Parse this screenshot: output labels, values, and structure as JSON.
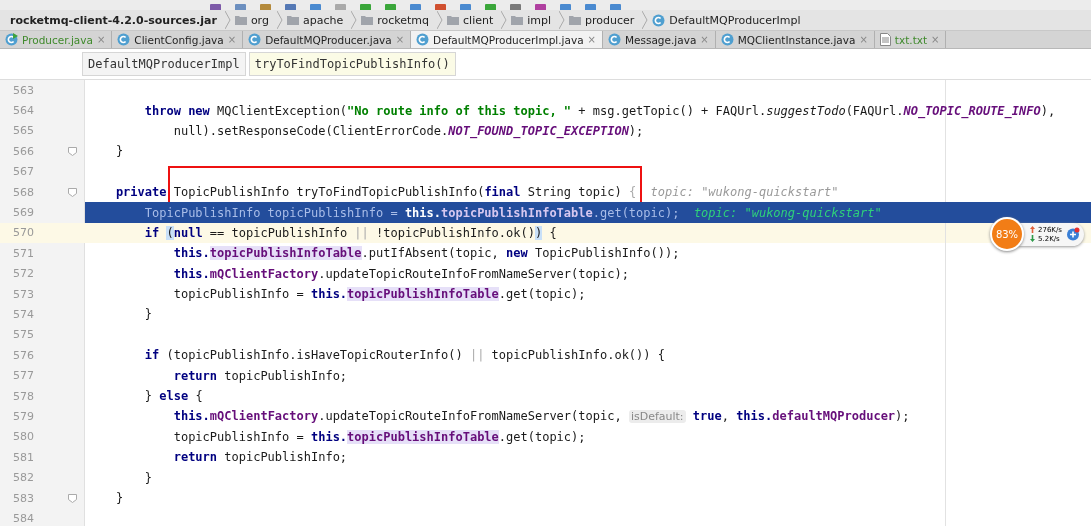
{
  "navigation_bar": {
    "items": [
      {
        "kind": "jar",
        "label": "rocketmq-client-4.2.0-sources.jar"
      },
      {
        "kind": "folder",
        "label": "org"
      },
      {
        "kind": "folder",
        "label": "apache"
      },
      {
        "kind": "folder",
        "label": "rocketmq"
      },
      {
        "kind": "folder",
        "label": "client"
      },
      {
        "kind": "folder",
        "label": "impl"
      },
      {
        "kind": "folder",
        "label": "producer"
      },
      {
        "kind": "class",
        "label": "DefaultMQProducerImpl"
      }
    ]
  },
  "tabs": [
    {
      "label": "Producer.java",
      "kind": "run_class",
      "vcs_added": true,
      "close": "×",
      "selected": false
    },
    {
      "label": "ClientConfig.java",
      "kind": "class",
      "vcs_added": false,
      "close": "×",
      "selected": false
    },
    {
      "label": "DefaultMQProducer.java",
      "kind": "class",
      "vcs_added": false,
      "close": "×",
      "selected": false
    },
    {
      "label": "DefaultMQProducerImpl.java",
      "kind": "class",
      "vcs_added": false,
      "close": "×",
      "selected": true
    },
    {
      "label": "Message.java",
      "kind": "class",
      "vcs_added": false,
      "close": "×",
      "selected": false
    },
    {
      "label": "MQClientInstance.java",
      "kind": "class",
      "vcs_added": false,
      "close": "×",
      "selected": false
    },
    {
      "label": "txt.txt",
      "kind": "text",
      "vcs_added": true,
      "close": "×",
      "selected": false
    }
  ],
  "structure_bar": [
    {
      "label": "DefaultMQProducerImpl",
      "selected": false
    },
    {
      "label": "tryToFindTopicPublishInfo()",
      "selected": true
    }
  ],
  "code": {
    "lines": [
      {
        "number": "563",
        "selected": false,
        "caret": false,
        "fold_marker": false
      },
      {
        "number": "564",
        "selected": false,
        "caret": false,
        "fold_marker": false,
        "tokens": [
          {
            "kind": "keyword",
            "text": "        throw new"
          },
          {
            "kind": "plain",
            "text": " MQClientException("
          },
          {
            "kind": "string",
            "text": "\"No route info of this topic, \""
          },
          {
            "kind": "plain",
            "text": " + msg.getTopic() + FAQUrl."
          },
          {
            "kind": "static",
            "text": "suggestTodo"
          },
          {
            "kind": "plain",
            "text": "(FAQUrl."
          },
          {
            "kind": "constant",
            "text": "NO_TOPIC_ROUTE_INFO"
          },
          {
            "kind": "plain",
            "text": "),"
          }
        ]
      },
      {
        "number": "565",
        "selected": false,
        "caret": false,
        "fold_marker": false,
        "tokens": [
          {
            "kind": "plain",
            "text": "            null).setResponseCode(ClientErrorCode."
          },
          {
            "kind": "constant",
            "text": "NOT_FOUND_TOPIC_EXCEPTION"
          },
          {
            "kind": "plain",
            "text": ");"
          }
        ]
      },
      {
        "number": "566",
        "selected": false,
        "caret": false,
        "fold_marker": true,
        "tokens": [
          {
            "kind": "plain",
            "text": "    }"
          }
        ]
      },
      {
        "number": "567",
        "selected": false,
        "caret": false,
        "fold_marker": false
      },
      {
        "number": "568",
        "selected": false,
        "caret": false,
        "fold_marker": true,
        "tokens": [
          {
            "kind": "keyword",
            "text": "    private "
          },
          {
            "kind": "plain",
            "text": "TopicPublishInfo tryToFindTopicPublishInfo(",
            "boxed": true
          },
          {
            "kind": "keyword",
            "text": "final",
            "boxed": true
          },
          {
            "kind": "plain",
            "text": " String topic)",
            "boxed": true
          },
          {
            "kind": "dim",
            "text": " {"
          },
          {
            "kind": "hint",
            "text": "  topic: \"wukong-quickstart\""
          }
        ]
      },
      {
        "number": "569",
        "selected": true,
        "caret": false,
        "fold_marker": false,
        "tokens": [
          {
            "kind": "plain",
            "text": "        TopicPublishInfo topicPublishInfo = "
          },
          {
            "kind": "keyword",
            "text": "this."
          },
          {
            "kind": "field",
            "text": "topicPublishInfoTable"
          },
          {
            "kind": "plain",
            "text": ".get(topic);"
          },
          {
            "kind": "hint",
            "text": "  topic: \"wukong-quickstart\""
          }
        ]
      },
      {
        "number": "570",
        "selected": false,
        "caret": true,
        "fold_marker": false,
        "tokens": [
          {
            "kind": "keyword",
            "text": "        if "
          },
          {
            "kind": "brace",
            "text": "("
          },
          {
            "kind": "keyword",
            "text": "null"
          },
          {
            "kind": "plain",
            "text": " == topicPublishInfo "
          },
          {
            "kind": "dim",
            "text": "||"
          },
          {
            "kind": "plain",
            "text": " !topicPublishInfo.ok()"
          },
          {
            "kind": "brace",
            "text": ")"
          },
          {
            "kind": "plain",
            "text": " {"
          }
        ]
      },
      {
        "number": "571",
        "selected": false,
        "caret": false,
        "fold_marker": false,
        "tokens": [
          {
            "kind": "keyword",
            "text": "            this."
          },
          {
            "kind": "field_usage",
            "text": "topicPublishInfoTable"
          },
          {
            "kind": "plain",
            "text": ".putIfAbsent(topic, "
          },
          {
            "kind": "keyword",
            "text": "new"
          },
          {
            "kind": "plain",
            "text": " TopicPublishInfo());"
          }
        ]
      },
      {
        "number": "572",
        "selected": false,
        "caret": false,
        "fold_marker": false,
        "tokens": [
          {
            "kind": "keyword",
            "text": "            this."
          },
          {
            "kind": "field",
            "text": "mQClientFactory"
          },
          {
            "kind": "plain",
            "text": ".updateTopicRouteInfoFromNameServer(topic);"
          }
        ]
      },
      {
        "number": "573",
        "selected": false,
        "caret": false,
        "fold_marker": false,
        "tokens": [
          {
            "kind": "plain",
            "text": "            topicPublishInfo = "
          },
          {
            "kind": "keyword",
            "text": "this."
          },
          {
            "kind": "field_usage",
            "text": "topicPublishInfoTable"
          },
          {
            "kind": "plain",
            "text": ".get(topic);"
          }
        ]
      },
      {
        "number": "574",
        "selected": false,
        "caret": false,
        "fold_marker": false,
        "tokens": [
          {
            "kind": "plain",
            "text": "        }"
          }
        ]
      },
      {
        "number": "575",
        "selected": false,
        "caret": false,
        "fold_marker": false
      },
      {
        "number": "576",
        "selected": false,
        "caret": false,
        "fold_marker": false,
        "tokens": [
          {
            "kind": "keyword",
            "text": "        if"
          },
          {
            "kind": "plain",
            "text": " (topicPublishInfo.isHaveTopicRouterInfo() "
          },
          {
            "kind": "dim",
            "text": "||"
          },
          {
            "kind": "plain",
            "text": " topicPublishInfo.ok()) {"
          }
        ]
      },
      {
        "number": "577",
        "selected": false,
        "caret": false,
        "fold_marker": false,
        "tokens": [
          {
            "kind": "keyword",
            "text": "            return"
          },
          {
            "kind": "plain",
            "text": " topicPublishInfo;"
          }
        ]
      },
      {
        "number": "578",
        "selected": false,
        "caret": false,
        "fold_marker": false,
        "tokens": [
          {
            "kind": "plain",
            "text": "        } "
          },
          {
            "kind": "keyword",
            "text": "else"
          },
          {
            "kind": "plain",
            "text": " {"
          }
        ]
      },
      {
        "number": "579",
        "selected": false,
        "caret": false,
        "fold_marker": false,
        "tokens": [
          {
            "kind": "keyword",
            "text": "            this."
          },
          {
            "kind": "field",
            "text": "mQClientFactory"
          },
          {
            "kind": "plain",
            "text": ".updateTopicRouteInfoFromNameServer(topic, "
          },
          {
            "kind": "inlay",
            "text": "isDefault:"
          },
          {
            "kind": "keyword",
            "text": " true"
          },
          {
            "kind": "plain",
            "text": ", "
          },
          {
            "kind": "keyword",
            "text": "this."
          },
          {
            "kind": "field",
            "text": "defaultMQProducer"
          },
          {
            "kind": "plain",
            "text": ");"
          }
        ]
      },
      {
        "number": "580",
        "selected": false,
        "caret": false,
        "fold_marker": false,
        "tokens": [
          {
            "kind": "plain",
            "text": "            topicPublishInfo = "
          },
          {
            "kind": "keyword",
            "text": "this."
          },
          {
            "kind": "field_usage",
            "text": "topicPublishInfoTable"
          },
          {
            "kind": "plain",
            "text": ".get(topic);"
          }
        ]
      },
      {
        "number": "581",
        "selected": false,
        "caret": false,
        "fold_marker": false,
        "tokens": [
          {
            "kind": "keyword",
            "text": "            return"
          },
          {
            "kind": "plain",
            "text": " topicPublishInfo;"
          }
        ]
      },
      {
        "number": "582",
        "selected": false,
        "caret": false,
        "fold_marker": false,
        "tokens": [
          {
            "kind": "plain",
            "text": "        }"
          }
        ]
      },
      {
        "number": "583",
        "selected": false,
        "caret": false,
        "fold_marker": true,
        "tokens": [
          {
            "kind": "plain",
            "text": "    }"
          }
        ]
      },
      {
        "number": "584",
        "selected": false,
        "caret": false,
        "fold_marker": false
      }
    ]
  },
  "network_widget": {
    "percent": "83%",
    "upload": "276K/s",
    "download": "5.2K/s"
  }
}
